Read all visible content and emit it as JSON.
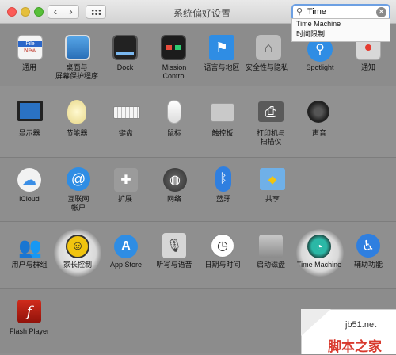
{
  "window": {
    "title": "系统偏好设置"
  },
  "search": {
    "value": "Time",
    "clear_glyph": "✕",
    "glyph": "⚲"
  },
  "suggestions": [
    "Time Machine",
    "时间限制"
  ],
  "nav": {
    "back": "‹",
    "forward": "›"
  },
  "sections": [
    {
      "id": "personal",
      "items": [
        {
          "label": "通用",
          "icon": "file-new-icon"
        },
        {
          "label": "桌面与\n屏幕保护程序",
          "icon": "desktop-icon"
        },
        {
          "label": "Dock",
          "icon": "dock-icon"
        },
        {
          "label": "Mission\nControl",
          "icon": "mission-control-icon"
        },
        {
          "label": "语言与地区",
          "icon": "flag-icon"
        },
        {
          "label": "安全性与隐私",
          "icon": "house-lock-icon"
        },
        {
          "label": "Spotlight",
          "icon": "magnifier-icon"
        },
        {
          "label": "通知",
          "icon": "notifications-icon"
        }
      ]
    },
    {
      "id": "hardware",
      "items": [
        {
          "label": "显示器",
          "icon": "display-icon"
        },
        {
          "label": "节能器",
          "icon": "lightbulb-icon"
        },
        {
          "label": "键盘",
          "icon": "keyboard-icon"
        },
        {
          "label": "鼠标",
          "icon": "mouse-icon"
        },
        {
          "label": "触控板",
          "icon": "trackpad-icon"
        },
        {
          "label": "打印机与\n扫描仪",
          "icon": "printer-icon"
        },
        {
          "label": "声音",
          "icon": "speaker-icon"
        }
      ]
    },
    {
      "id": "internet",
      "items": [
        {
          "label": "iCloud",
          "icon": "cloud-icon"
        },
        {
          "label": "互联网\n帐户",
          "icon": "at-sign-icon"
        },
        {
          "label": "扩展",
          "icon": "puzzle-icon"
        },
        {
          "label": "网络",
          "icon": "globe-icon"
        },
        {
          "label": "蓝牙",
          "icon": "bluetooth-icon"
        },
        {
          "label": "共享",
          "icon": "sharing-folder-icon"
        }
      ]
    },
    {
      "id": "system",
      "items": [
        {
          "label": "用户与群组",
          "icon": "users-icon"
        },
        {
          "label": "家长控制",
          "icon": "parental-controls-icon",
          "highlighted": true
        },
        {
          "label": "App Store",
          "icon": "app-store-icon"
        },
        {
          "label": "听写与语音",
          "icon": "microphone-icon"
        },
        {
          "label": "日期与时间",
          "icon": "clock-calendar-icon"
        },
        {
          "label": "启动磁盘",
          "icon": "hard-disk-icon"
        },
        {
          "label": "Time Machine",
          "icon": "time-machine-icon",
          "highlighted": true
        },
        {
          "label": "辅助功能",
          "icon": "accessibility-icon"
        }
      ]
    },
    {
      "id": "other",
      "items": [
        {
          "label": "Flash Player",
          "icon": "flash-icon"
        }
      ]
    }
  ],
  "watermark": {
    "url": "jb51.net",
    "name": "脚本之家"
  }
}
